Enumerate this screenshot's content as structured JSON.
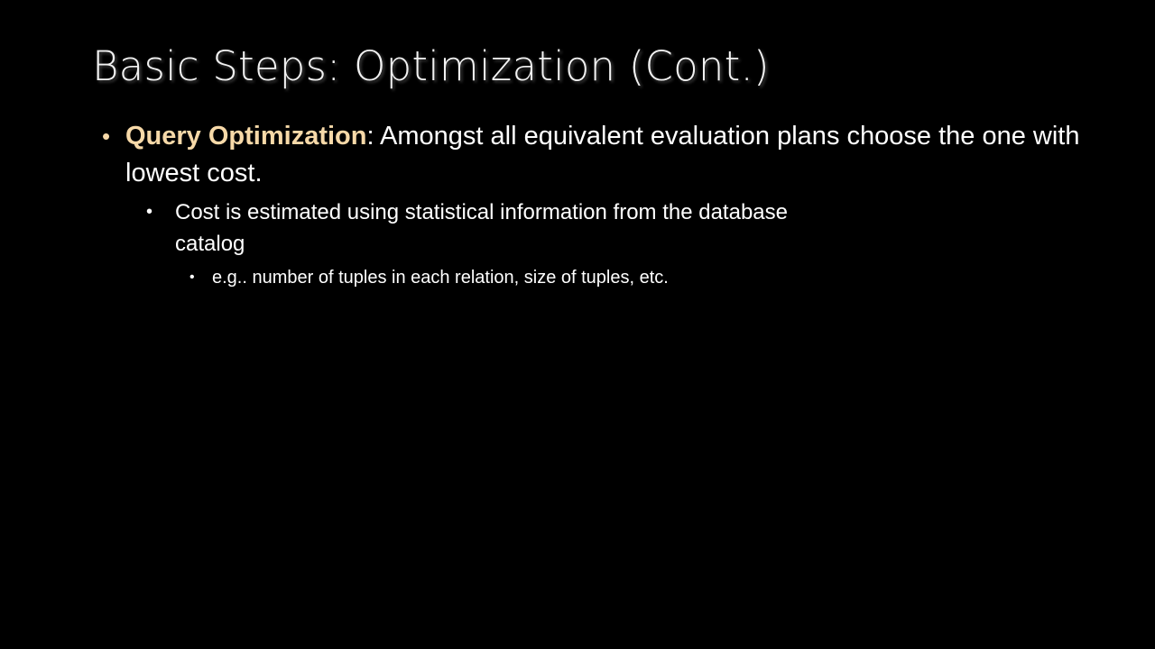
{
  "slide": {
    "title": "Basic Steps: Optimization (Cont.)",
    "bullets": {
      "level1": {
        "bullet_char": "•",
        "highlight": "Query Optimization",
        "text": ": Amongst all equivalent evaluation plans choose the one with lowest cost."
      },
      "level2": {
        "bullet_char": "•",
        "text": "Cost is estimated using statistical information from the database catalog"
      },
      "level3": {
        "bullet_char": "•",
        "text": "e.g.. number of tuples in each relation, size of tuples, etc."
      }
    }
  },
  "colors": {
    "background": "#000000",
    "text": "#ffffff",
    "accent": "#f7d9a8"
  }
}
